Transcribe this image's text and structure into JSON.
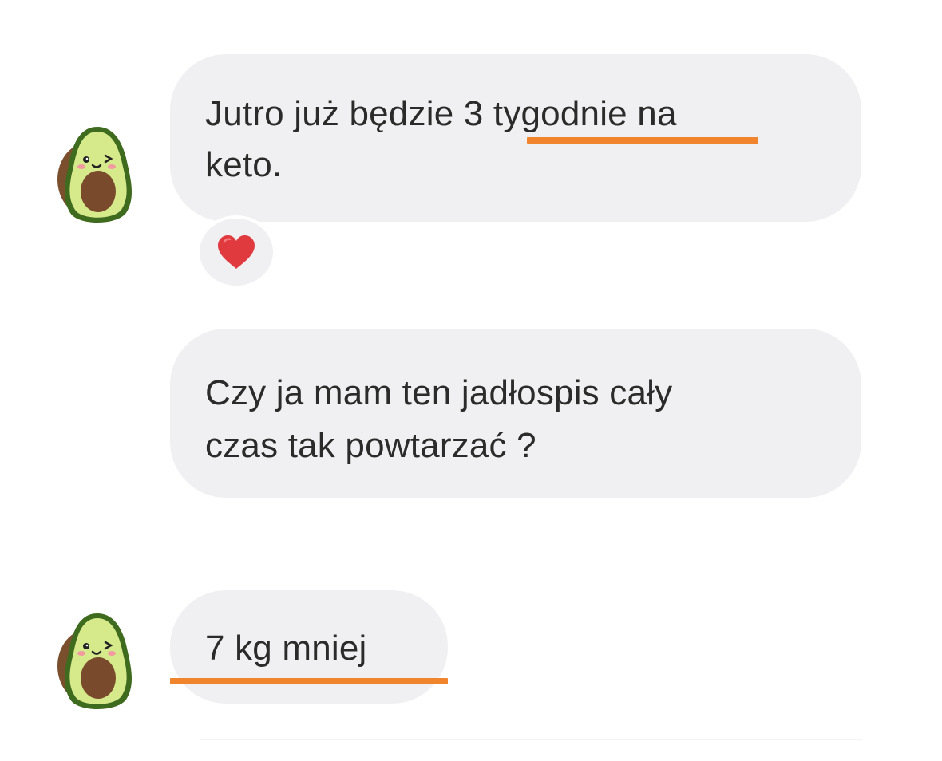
{
  "messages": [
    {
      "line1": "Jutro już będzie 3 tygodnie na",
      "line2": "keto.",
      "highlight": "3 tygodnie",
      "reaction": "heart-emoji"
    },
    {
      "line1": "Czy ja mam ten jadłospis cały",
      "line2": "czas tak powtarzać ?"
    },
    {
      "line1": "7 kg mniej",
      "highlight": "7 kg mniej"
    }
  ],
  "avatar": {
    "icon": "avocado-icon",
    "skin_color": "#4f7a29",
    "flesh_color": "#d4e88a",
    "pit_color": "#7a4a2c"
  },
  "colors": {
    "bubble": "#f0f0f2",
    "text": "#2b2b2b",
    "underline": "#f0852d",
    "heart": "#e0393e"
  }
}
